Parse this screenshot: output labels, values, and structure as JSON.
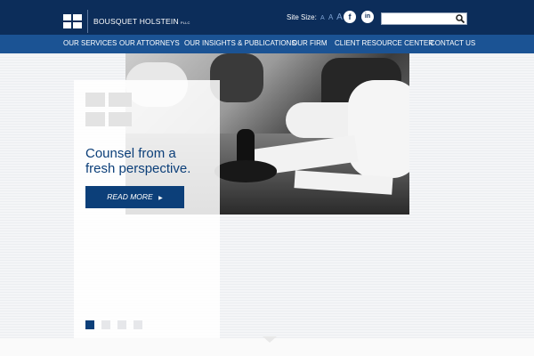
{
  "header": {
    "logo_name": "BOUSQUET HOLSTEIN",
    "logo_suffix": "PLLC",
    "site_size_label": "Site Size:",
    "size_small": "A",
    "size_medium": "A",
    "size_large": "A",
    "social": [
      {
        "icon": "facebook-icon",
        "glyph": "f"
      },
      {
        "icon": "linkedin-icon",
        "glyph": "in"
      }
    ],
    "search_placeholder": ""
  },
  "nav": {
    "items": [
      {
        "label": "OUR SERVICES"
      },
      {
        "label": "OUR ATTORNEYS"
      },
      {
        "label": "OUR INSIGHTS & PUBLICATIONS"
      },
      {
        "label": "OUR FIRM"
      },
      {
        "label": "CLIENT RESOURCE CENTER"
      },
      {
        "label": "CONTACT US"
      }
    ]
  },
  "hero": {
    "tagline_line1": "Counsel from a",
    "tagline_line2": "fresh perspective.",
    "button_label": "READ MORE",
    "button_icon": "triangle-right-icon"
  },
  "slider": {
    "total": 4,
    "active": 1
  },
  "colors": {
    "header_bg": "#0c2d5a",
    "nav_bg": "#1b5394",
    "accent": "#0c3f79"
  }
}
